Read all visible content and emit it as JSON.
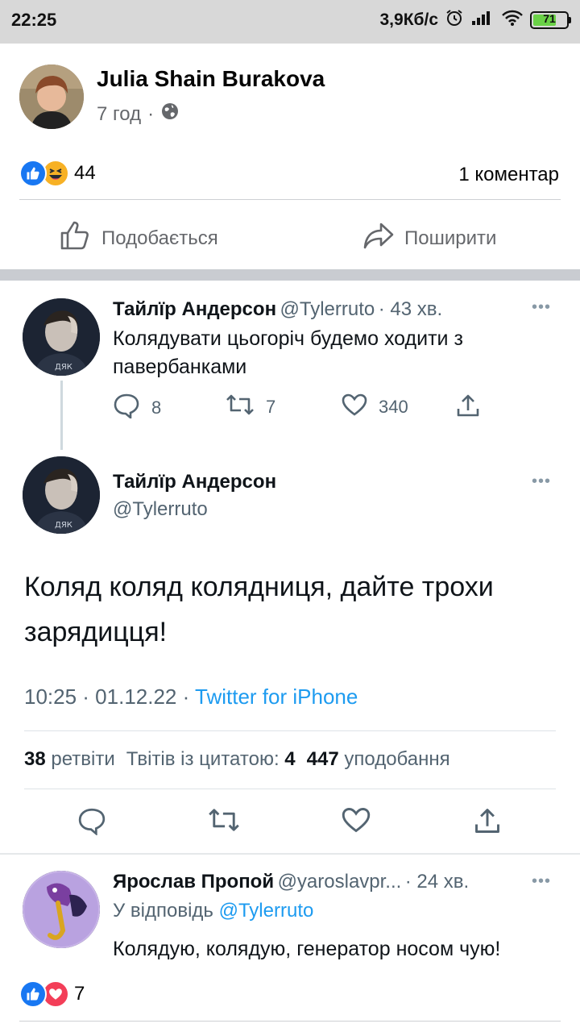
{
  "status_bar": {
    "time": "22:25",
    "speed": "3,9Кб/с",
    "battery": "71"
  },
  "post": {
    "author": "Julia Shain Burakova",
    "time": "7 год",
    "reaction_count": "44",
    "comments": "1 коментар",
    "like_label": "Подобається",
    "share_label": "Поширити"
  },
  "tweet_thread": {
    "first": {
      "name": "Тайлїр Андерсон",
      "handle": "@Tylerruto",
      "time": "· 43 хв.",
      "text": "Колядувати цьогоріч будемо ходити з павербанками",
      "replies": "8",
      "retweets": "7",
      "likes": "340"
    },
    "main": {
      "name": "Тайлїр Андерсон",
      "handle": "@Tylerruto",
      "text": "Коляд коляд колядниця, дайте трохи зарядицця!",
      "timestamp": "10:25 · 01.12.22 · ",
      "source": "Twitter for iPhone",
      "retweets_count": "38",
      "retweets_label": "ретвіти",
      "quotes_label": "Твітів із цитатою:",
      "quotes_count": "4",
      "likes_count": "447",
      "likes_label": "уподобання"
    },
    "reply": {
      "name": "Ярослав Пропой",
      "handle": "@yaroslavpr...",
      "time": "· 24 хв.",
      "reply_prefix": "У відповідь",
      "reply_mention": "@Tylerruto",
      "text": "Колядую, колядую, генератор носом чую!"
    }
  },
  "bottom_reactions": {
    "count": "7"
  },
  "icons": [
    "alarm-icon",
    "signal-icon",
    "wifi-icon",
    "globe-icon",
    "like-icon",
    "haha-icon",
    "love-icon",
    "share-icon",
    "reply-icon",
    "retweet-icon",
    "heart-icon",
    "upload-icon",
    "more-icon"
  ],
  "colors": {
    "facebook_blue": "#1877f2",
    "twitter_blue": "#1d9bf0",
    "meta_gray": "#65676b"
  }
}
